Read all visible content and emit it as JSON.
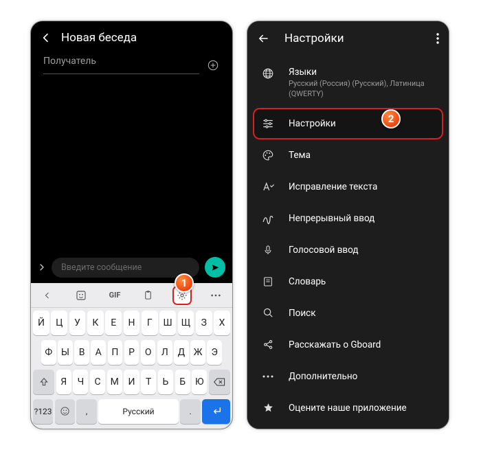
{
  "left": {
    "title": "Новая беседа",
    "recipient_placeholder": "Получатель",
    "input_placeholder": "Введите сообщение",
    "keyboard": {
      "gif_label": "GIF",
      "row1": [
        "Й",
        "Ц",
        "У",
        "К",
        "Е",
        "Н",
        "Г",
        "Ш",
        "Щ",
        "З",
        "Х"
      ],
      "row2": [
        "Ф",
        "Ы",
        "В",
        "А",
        "П",
        "Р",
        "О",
        "Л",
        "Д",
        "Ж",
        "Э"
      ],
      "row3": [
        "Я",
        "Ч",
        "С",
        "М",
        "И",
        "Т",
        "Ь",
        "Б",
        "Ю"
      ],
      "sym_key": "?123",
      "space_label": "Русский",
      "dot_key": "."
    }
  },
  "right": {
    "title": "Настройки",
    "items": {
      "lang_label": "Языки",
      "lang_sub": "Русский (Россия) (Русский), Латиница (QWERTY)",
      "prefs": "Настройки",
      "theme": "Тема",
      "text_correction": "Исправление текста",
      "glide": "Непрерывный ввод",
      "voice": "Голосовой ввод",
      "dict": "Словарь",
      "search": "Поиск",
      "share": "Расскажать о Gboard",
      "advanced": "Дополнительно",
      "rate": "Оцените наше приложение"
    }
  },
  "callouts": {
    "one": "1",
    "two": "2"
  }
}
